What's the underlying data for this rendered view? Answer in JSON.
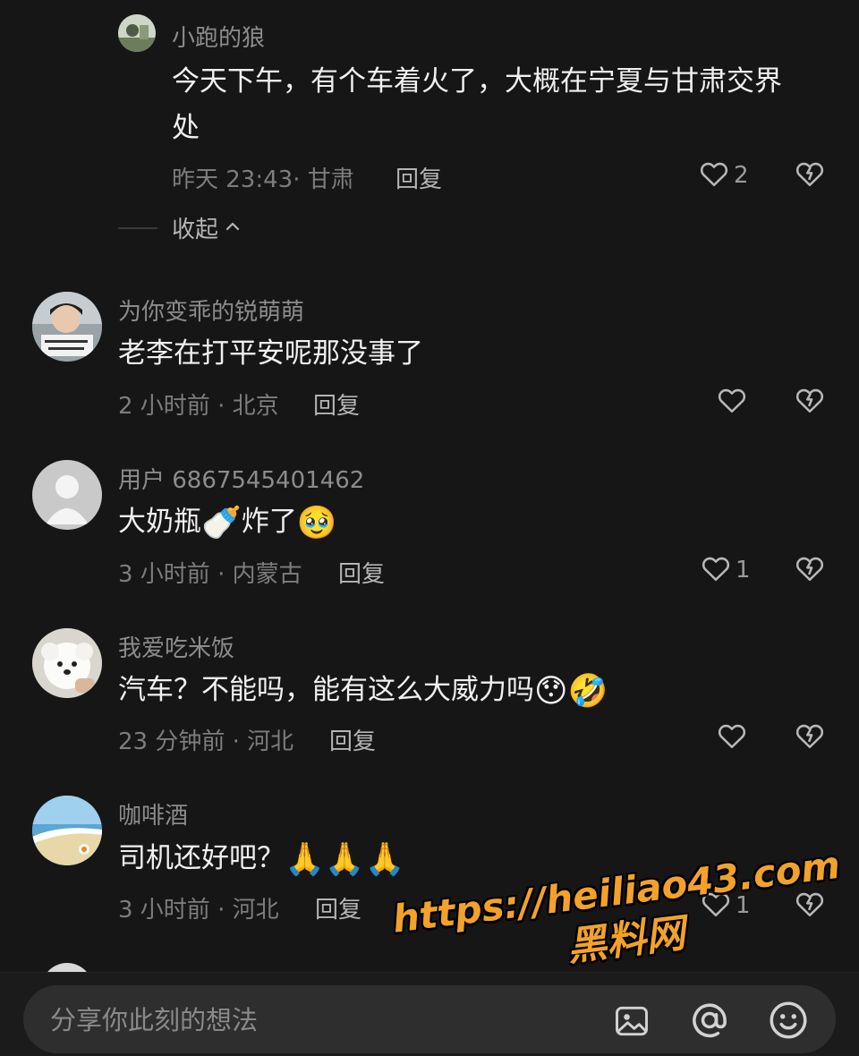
{
  "comments": [
    {
      "username": "小跑的狼",
      "text_lines": [
        "今天下午，有个车着火了，大概在宁夏与甘肃交界",
        "处"
      ],
      "meta": "昨天 23:43· 甘肃",
      "reply_label": "回复",
      "like_count": "2"
    },
    {
      "username": "为你变乖的锐萌萌",
      "text": "老李在打平安呢那没事了",
      "meta": "2 小时前 · 北京",
      "reply_label": "回复",
      "like_count": ""
    },
    {
      "username": "用户 6867545401462",
      "text_a": "大奶瓶",
      "emoji_a": "🍼",
      "text_b": "炸了",
      "emoji_b": "🥹",
      "meta": "3 小时前 · 内蒙古",
      "reply_label": "回复",
      "like_count": "1"
    },
    {
      "username": "我爱吃米饭",
      "text": "汽车？不能吗，能有这么大威力吗",
      "emoji_a": "😯",
      "emoji_b": "🤣",
      "meta": "23 分钟前 · 河北",
      "reply_label": "回复",
      "like_count": ""
    },
    {
      "username": "咖啡酒",
      "text": "司机还好吧？",
      "emoji": "🙏",
      "meta": "3 小时前 · 河北",
      "reply_label": "回复",
      "like_count": "1"
    }
  ],
  "collapse_label": "收起",
  "input": {
    "placeholder": "分享你此刻的想法"
  },
  "icons": {
    "like": "heart-outline-icon",
    "dislike": "broken-heart-icon",
    "image": "image-icon",
    "mention": "at-icon",
    "emoji": "smiley-icon"
  },
  "watermark": {
    "url": "https://heiliao43.com",
    "name": "黑料网"
  },
  "colors": {
    "background": "#161616",
    "text": "#f0f0f0",
    "muted": "#8c8c8c",
    "watermark": "#f2a22a"
  }
}
